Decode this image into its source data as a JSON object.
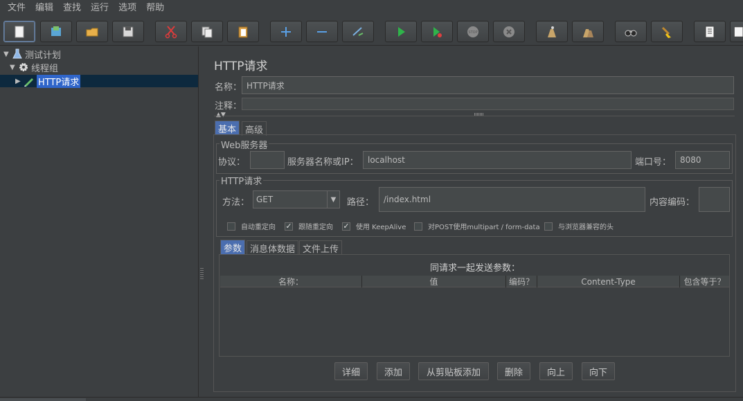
{
  "menu": [
    "文件",
    "编辑",
    "查找",
    "运行",
    "选项",
    "帮助"
  ],
  "toolbar": {
    "icons": [
      "new-icon",
      "templates-icon",
      "open-icon",
      "save-icon",
      "cut-icon",
      "copy-icon",
      "paste-icon",
      "expand-icon",
      "collapse-icon",
      "toggle-icon",
      "start-icon",
      "start-no-pause-icon",
      "stop-icon",
      "shutdown-icon",
      "clear-icon",
      "clear-all-icon",
      "search-icon",
      "reset-search-icon",
      "function-helper-icon",
      "help-icon"
    ]
  },
  "tree": {
    "plan": "测试计划",
    "thread_group": "线程组",
    "sampler": "HTTP请求"
  },
  "panel": {
    "title": "HTTP请求",
    "name_label": "名称：",
    "name_value": "HTTP请求",
    "comment_label": "注释："
  },
  "tabs": {
    "basic": "基本",
    "advanced": "高级"
  },
  "web_server": {
    "group_title": "Web服务器",
    "protocol_label": "协议：",
    "protocol_value": "",
    "server_label": "服务器名称或IP：",
    "server_value": "localhost",
    "port_label": "端口号：",
    "port_value": "8080"
  },
  "http_request": {
    "group_title": "HTTP请求",
    "method_label": "方法：",
    "method_value": "GET",
    "path_label": "路径：",
    "path_value": "/index.html",
    "encoding_label": "内容编码：",
    "encoding_value": ""
  },
  "checkboxes": [
    {
      "label": "自动重定向",
      "checked": false
    },
    {
      "label": "跟随重定向",
      "checked": true
    },
    {
      "label": "使用 KeepAlive",
      "checked": true
    },
    {
      "label": "对POST使用multipart / form-data",
      "checked": false
    },
    {
      "label": "与浏览器兼容的头",
      "checked": false
    }
  ],
  "subtabs": {
    "params": "参数",
    "body": "消息体数据",
    "files": "文件上传"
  },
  "params": {
    "caption": "同请求一起发送参数：",
    "columns": [
      "名称：",
      "值",
      "编码？",
      "Content-Type",
      "包含等于？"
    ]
  },
  "buttons": {
    "detail": "详细",
    "add": "添加",
    "add_clipboard": "从剪贴板添加",
    "delete": "删除",
    "up": "向上",
    "down": "向下"
  }
}
